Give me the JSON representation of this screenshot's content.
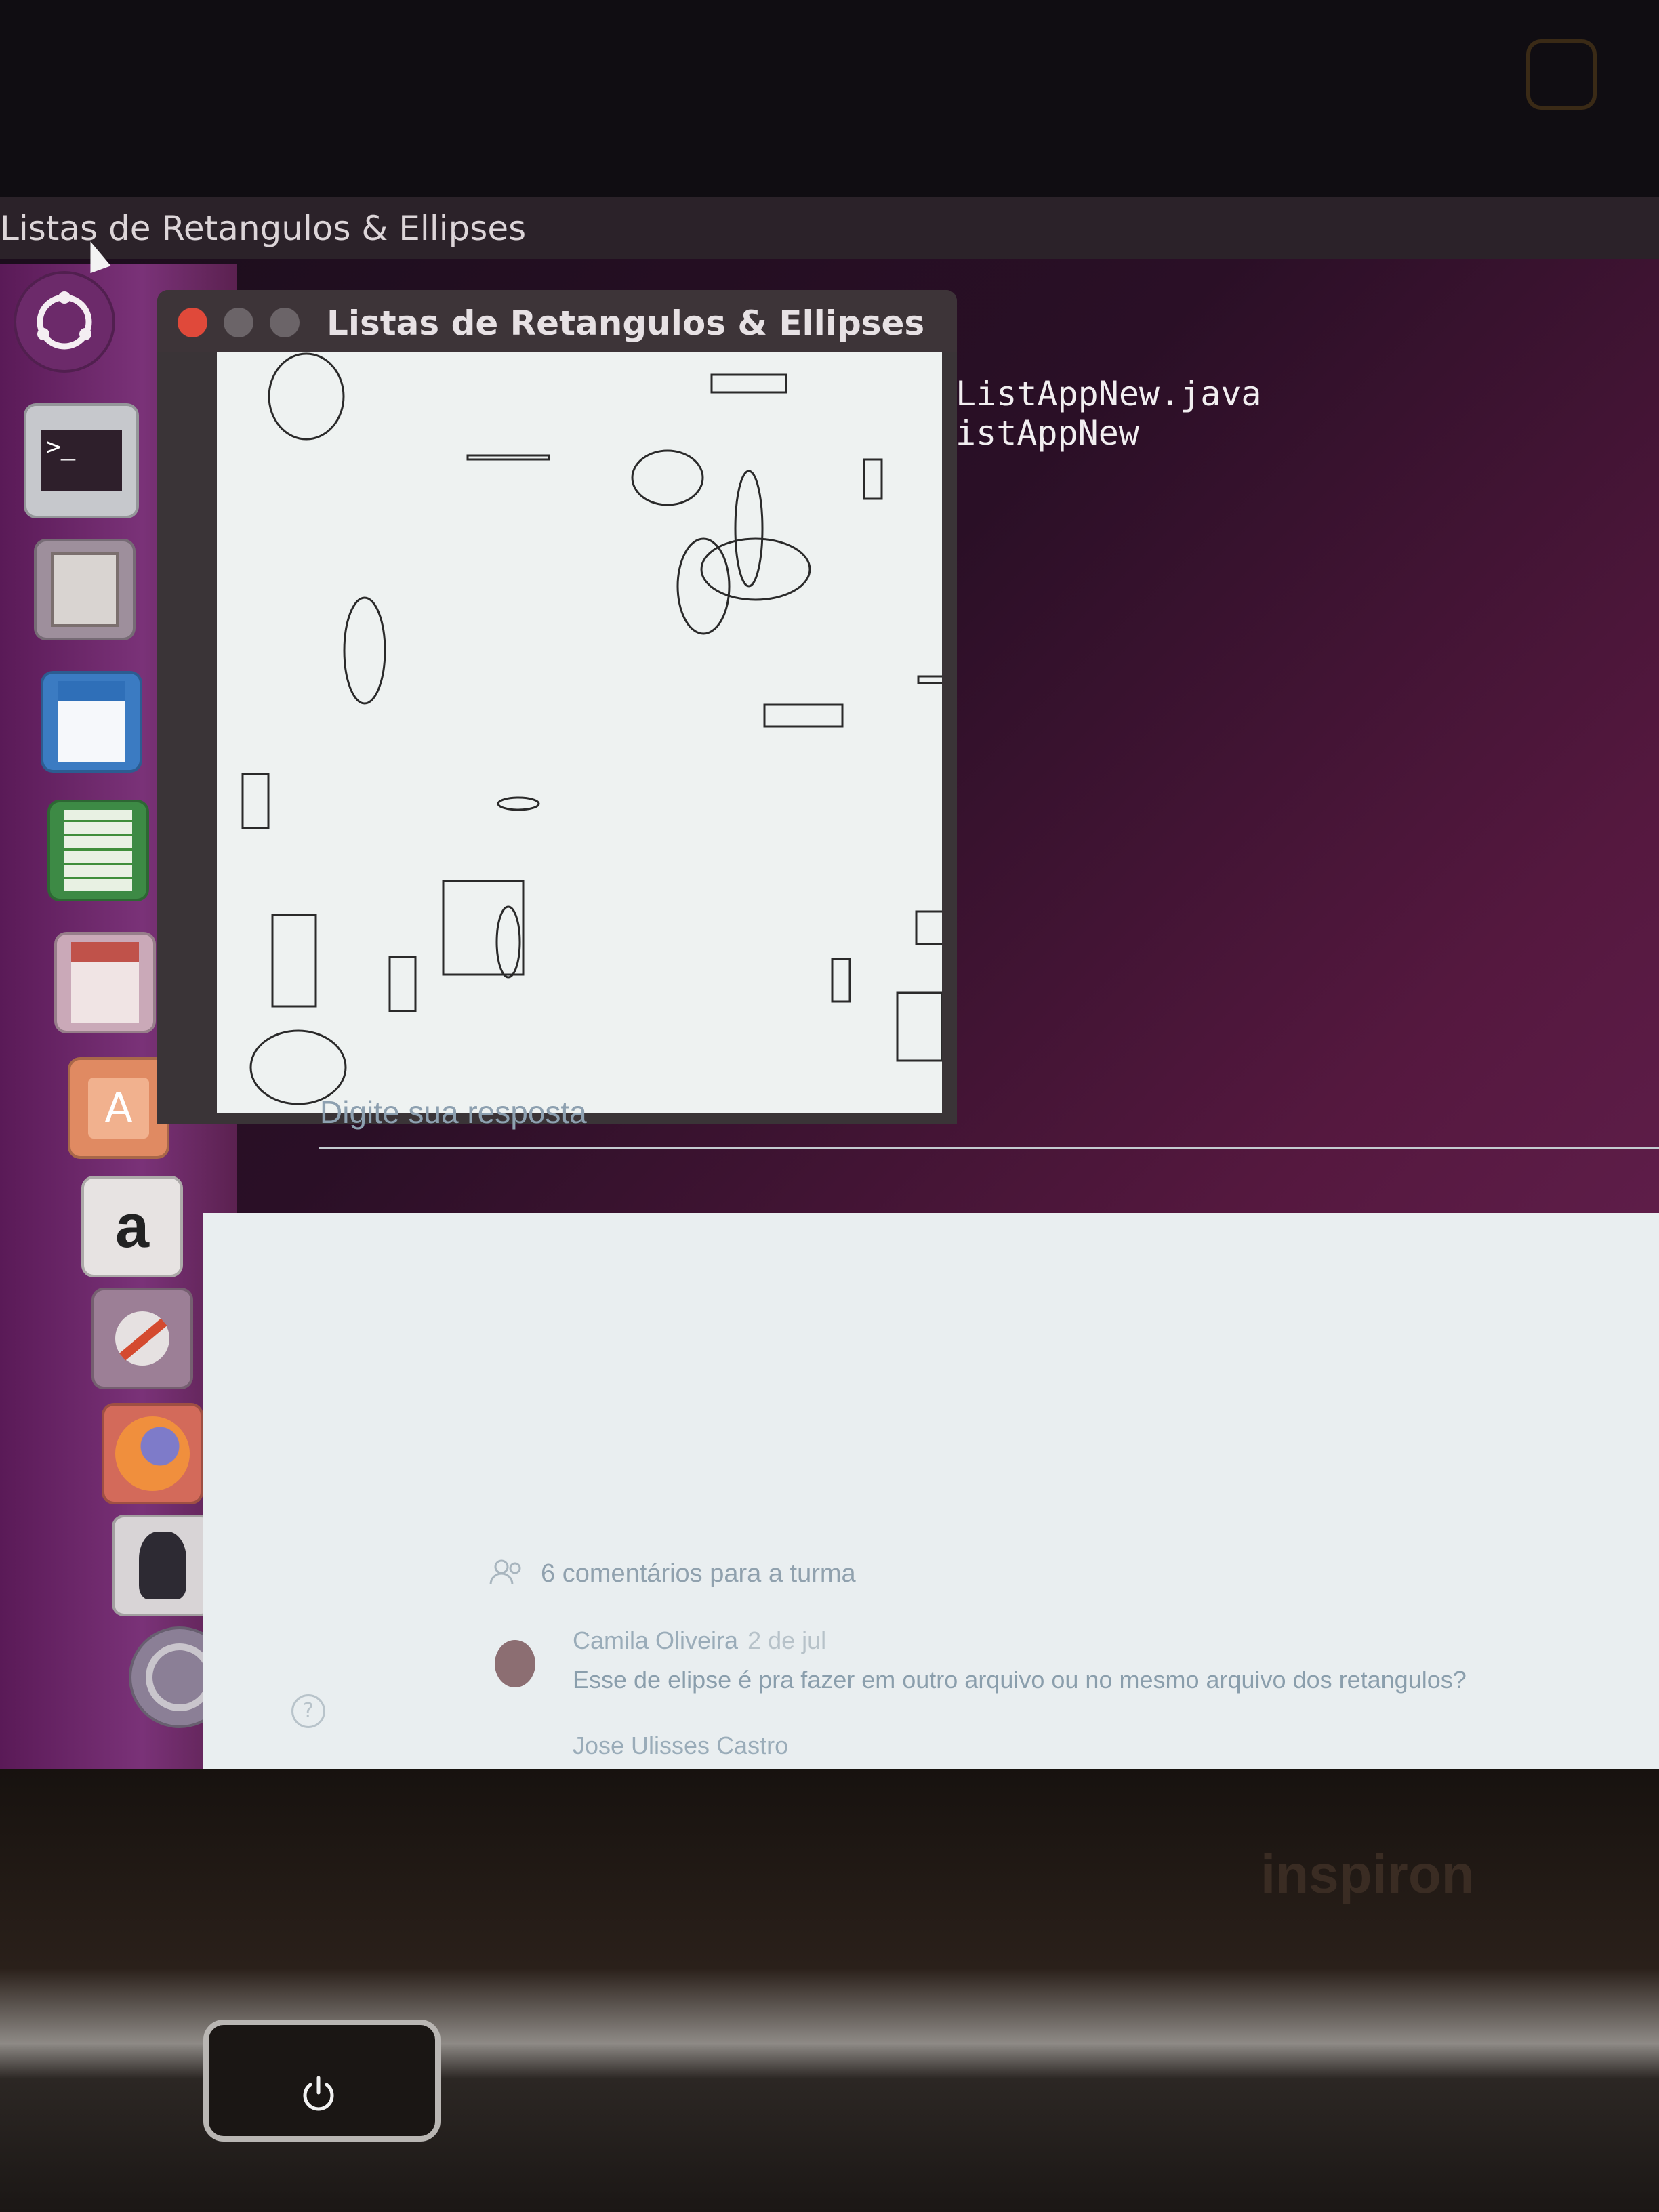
{
  "top_panel": {
    "title": "Listas de Retangulos & Ellipses"
  },
  "app_window": {
    "title": "Listas de Retangulos & Ellipses"
  },
  "terminal": {
    "lines": [
      "ListAppNew.java",
      "istAppNew"
    ]
  },
  "launcher": {
    "items": [
      {
        "name": "ubuntu-dash",
        "icon": "ubuntu-logo-icon"
      },
      {
        "name": "terminal",
        "icon": "terminal-icon"
      },
      {
        "name": "files",
        "icon": "file-cabinet-icon"
      },
      {
        "name": "libreoffice-writer",
        "icon": "writer-document-icon"
      },
      {
        "name": "libreoffice-calc",
        "icon": "spreadsheet-icon"
      },
      {
        "name": "libreoffice-impress",
        "icon": "presentation-icon"
      },
      {
        "name": "software-center",
        "icon": "shopping-bag-icon"
      },
      {
        "name": "amazon",
        "icon": "amazon-icon"
      },
      {
        "name": "system-settings",
        "icon": "settings-wrench-icon"
      },
      {
        "name": "firefox",
        "icon": "firefox-icon"
      },
      {
        "name": "java",
        "icon": "java-duke-icon"
      },
      {
        "name": "software-updater",
        "icon": "updater-icon"
      }
    ]
  },
  "classroom": {
    "reply_placeholder": "Digite sua resposta",
    "comments_count": "6 comentários para a turma",
    "comments": [
      {
        "author": "Camila Oliveira",
        "date": "2 de jul",
        "text": "Esse de elipse é pra fazer em outro arquivo ou no mesmo arquivo dos retangulos?"
      },
      {
        "author": "Jose Ulisses Castro",
        "date": "",
        "text": ""
      }
    ]
  },
  "laptop": {
    "brand": "inspiron"
  },
  "colors": {
    "launcher": "#7a3278",
    "desktop_accent": "#6a2456",
    "close_button": "#e0493a"
  }
}
